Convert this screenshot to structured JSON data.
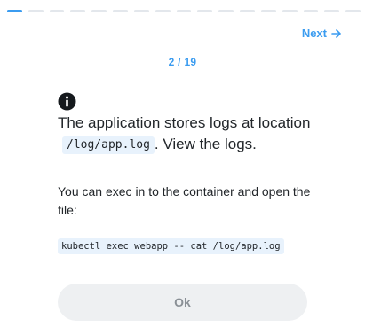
{
  "progress": {
    "current_step": 2,
    "total_steps": 19,
    "visible_segments": 17,
    "active_segment_index": 0,
    "accent_color": "#3b9cf0",
    "inactive_color": "#e3e7ec"
  },
  "nav": {
    "next_label": "Next",
    "next_icon": "arrow-right-icon"
  },
  "step_counter": "2 / 19",
  "question": {
    "icon": "info-icon",
    "text_before": "The application stores logs at location",
    "code": "/log/app.log",
    "text_after": ". View the logs."
  },
  "hint": {
    "text": "You can exec in to the container and open the file:",
    "command": "kubectl exec webapp -- cat /log/app.log"
  },
  "ok_button": {
    "label": "Ok"
  }
}
